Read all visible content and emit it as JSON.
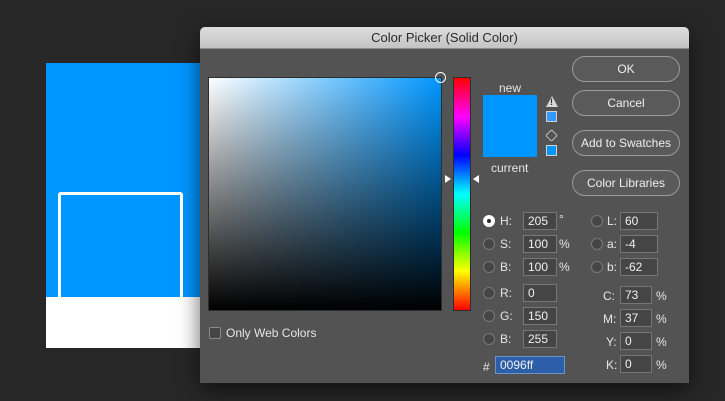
{
  "dialog": {
    "title": "Color Picker (Solid Color)"
  },
  "colors": {
    "new": "#0096ff",
    "current": "#0096ff",
    "hue_slider": "#0096ff",
    "websafe_swatch": "#3399ff",
    "gamut_swatch": "#0096ff"
  },
  "preview": {
    "new_label": "new",
    "current_label": "current"
  },
  "buttons": {
    "ok": "OK",
    "cancel": "Cancel",
    "add_to_swatches": "Add to Swatches",
    "color_libraries": "Color Libraries"
  },
  "fields": {
    "H": {
      "label": "H:",
      "value": "205",
      "unit": "°",
      "selected": true
    },
    "S": {
      "label": "S:",
      "value": "100",
      "unit": "%"
    },
    "Bv": {
      "label": "B:",
      "value": "100",
      "unit": "%"
    },
    "R": {
      "label": "R:",
      "value": "0"
    },
    "G": {
      "label": "G:",
      "value": "150"
    },
    "Bc": {
      "label": "B:",
      "value": "255"
    },
    "L": {
      "label": "L:",
      "value": "60"
    },
    "a": {
      "label": "a:",
      "value": "-4"
    },
    "b": {
      "label": "b:",
      "value": "-62"
    },
    "C": {
      "label": "C:",
      "value": "73",
      "unit": "%"
    },
    "M": {
      "label": "M:",
      "value": "37",
      "unit": "%"
    },
    "Y": {
      "label": "Y:",
      "value": "0",
      "unit": "%"
    },
    "K": {
      "label": "K:",
      "value": "0",
      "unit": "%"
    }
  },
  "hex": {
    "label": "#",
    "value": "0096ff"
  },
  "web_colors": {
    "label": "Only Web Colors",
    "checked": false
  },
  "icons": {
    "out_of_gamut": "warning-triangle-icon",
    "not_web_safe": "cube-icon"
  }
}
